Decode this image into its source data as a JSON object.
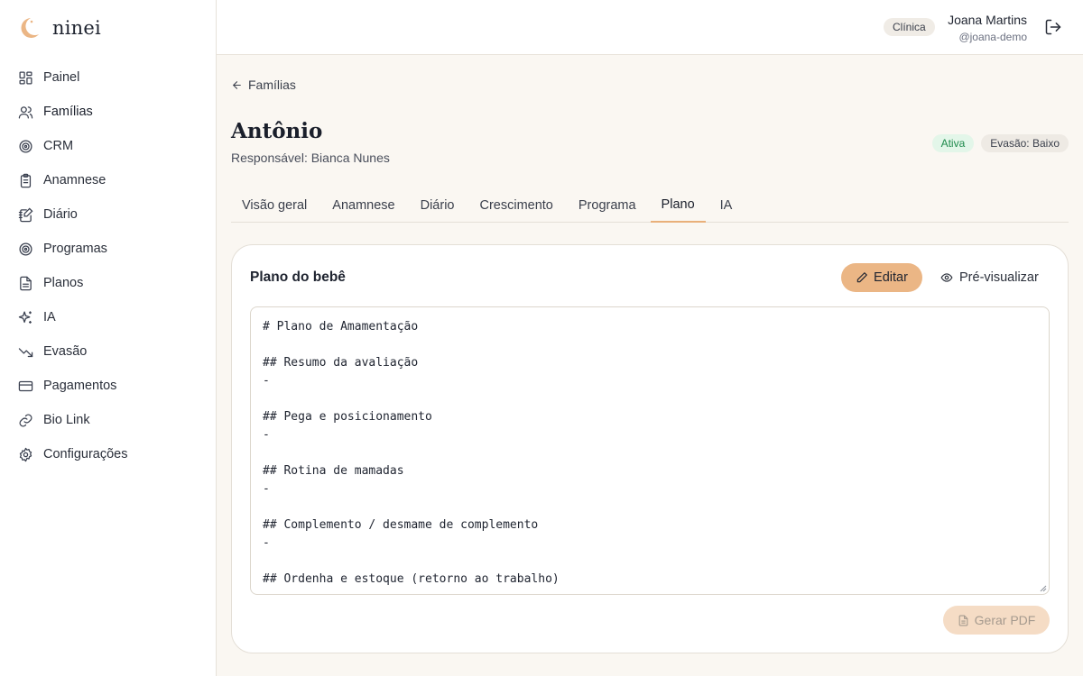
{
  "brand": {
    "name": "ninei",
    "accent": "#e9b07a"
  },
  "sidebar": {
    "items": [
      {
        "label": "Painel",
        "icon": "dashboard-icon"
      },
      {
        "label": "Famílias",
        "icon": "users-icon",
        "active": true
      },
      {
        "label": "CRM",
        "icon": "target-icon"
      },
      {
        "label": "Anamnese",
        "icon": "clipboard-icon"
      },
      {
        "label": "Diário",
        "icon": "notebook-pen-icon"
      },
      {
        "label": "Programas",
        "icon": "target-icon"
      },
      {
        "label": "Planos",
        "icon": "file-text-icon"
      },
      {
        "label": "IA",
        "icon": "sparkles-icon"
      },
      {
        "label": "Evasão",
        "icon": "trending-down-icon"
      },
      {
        "label": "Pagamentos",
        "icon": "credit-card-icon"
      },
      {
        "label": "Bio Link",
        "icon": "link-icon"
      },
      {
        "label": "Configurações",
        "icon": "gear-icon"
      }
    ]
  },
  "topbar": {
    "role": "Clínica",
    "user_name": "Joana Martins",
    "user_handle": "@joana-demo"
  },
  "page": {
    "back_label": "Famílias",
    "client_name": "Antônio",
    "responsible": "Responsável: Bianca Nunes",
    "status_active": "Ativa",
    "evasion": "Evasão: Baixo"
  },
  "tabs": [
    {
      "label": "Visão geral"
    },
    {
      "label": "Anamnese"
    },
    {
      "label": "Diário"
    },
    {
      "label": "Crescimento"
    },
    {
      "label": "Programa"
    },
    {
      "label": "Plano",
      "active": true
    },
    {
      "label": "IA"
    }
  ],
  "plan_card": {
    "title": "Plano do bebê",
    "edit_label": "Editar",
    "preview_label": "Pré-visualizar",
    "pdf_label": "Gerar PDF",
    "content": "# Plano de Amamentação\n\n## Resumo da avaliação\n-\n\n## Pega e posicionamento\n-\n\n## Rotina de mamadas\n-\n\n## Complemento / desmame de complemento\n-\n\n## Ordenha e estoque (retorno ao trabalho)"
  }
}
